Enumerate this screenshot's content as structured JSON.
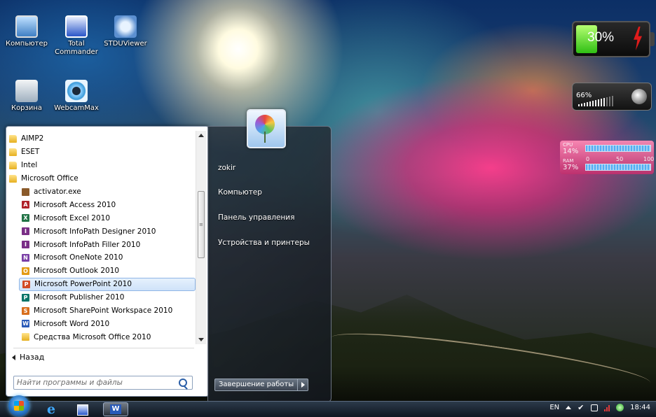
{
  "desktop": {
    "icons": [
      {
        "label": "Компьютер"
      },
      {
        "label": "Total Commander"
      },
      {
        "label": "STDUViewer"
      },
      {
        "label": "Корзина"
      },
      {
        "label": "WebcamMax"
      }
    ]
  },
  "gadgets": {
    "battery": {
      "percent_label": "30%",
      "level_fraction": 0.3
    },
    "volume": {
      "percent_label": "66%",
      "level_fraction": 0.66
    },
    "cpu_meter": {
      "cpu_label": "CPU",
      "cpu_value": "14%",
      "ram_label": "RAM",
      "ram_value": "37%",
      "scale": [
        "0",
        "50",
        "100"
      ]
    }
  },
  "start_menu": {
    "programs": [
      {
        "label": "AIMP2",
        "icon": "folder-icon",
        "level": 0
      },
      {
        "label": "ESET",
        "icon": "folder-icon",
        "level": 0
      },
      {
        "label": "Intel",
        "icon": "folder-icon",
        "level": 0
      },
      {
        "label": "Microsoft Office",
        "icon": "folder-icon",
        "level": 0
      },
      {
        "label": "activator.exe",
        "icon": "activator-icon",
        "level": 1
      },
      {
        "label": "Microsoft Access 2010",
        "icon": "access-icon",
        "level": 1
      },
      {
        "label": "Microsoft Excel 2010",
        "icon": "excel-icon",
        "level": 1
      },
      {
        "label": "Microsoft InfoPath Designer 2010",
        "icon": "infopath-designer-icon",
        "level": 1
      },
      {
        "label": "Microsoft InfoPath Filler 2010",
        "icon": "infopath-filler-icon",
        "level": 1
      },
      {
        "label": "Microsoft OneNote 2010",
        "icon": "onenote-icon",
        "level": 1
      },
      {
        "label": "Microsoft Outlook 2010",
        "icon": "outlook-icon",
        "level": 1
      },
      {
        "label": "Microsoft PowerPoint 2010",
        "icon": "powerpoint-icon",
        "level": 1,
        "selected": true
      },
      {
        "label": "Microsoft Publisher 2010",
        "icon": "publisher-icon",
        "level": 1
      },
      {
        "label": "Microsoft SharePoint Workspace 2010",
        "icon": "sharepoint-icon",
        "level": 1
      },
      {
        "label": "Microsoft Word 2010",
        "icon": "word-icon",
        "level": 1
      },
      {
        "label": "Средства Microsoft Office 2010",
        "icon": "office-tools-folder-icon",
        "level": 1
      }
    ],
    "back_label": "Назад",
    "search_placeholder": "Найти программы и файлы",
    "right": {
      "user": "zokir",
      "computer": "Компьютер",
      "control_panel": "Панель управления",
      "devices": "Устройства и принтеры",
      "shutdown": "Завершение работы"
    }
  },
  "taskbar": {
    "language": "EN",
    "time": "18:44"
  }
}
